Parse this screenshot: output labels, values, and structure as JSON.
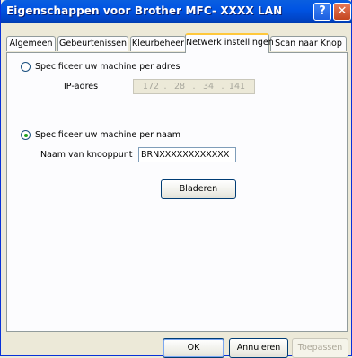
{
  "window": {
    "title": "Eigenschappen voor Brother MFC- XXXX   LAN",
    "help_glyph": "?",
    "close_glyph": "✕"
  },
  "tabs": [
    {
      "label": "Algemeen",
      "active": false
    },
    {
      "label": "Gebeurtenissen",
      "active": false
    },
    {
      "label": "Kleurbeheer",
      "active": false
    },
    {
      "label": "Netwerk instellingen",
      "active": true
    },
    {
      "label": "Scan naar Knop",
      "active": false
    }
  ],
  "address_mode": {
    "label": "Specificeer uw machine per adres",
    "checked": false,
    "ip_label": "IP-adres",
    "ip_octets": [
      "172",
      "28",
      "34",
      "141"
    ],
    "ip_enabled": false
  },
  "name_mode": {
    "label": "Specificeer uw machine per naam",
    "checked": true,
    "node_label": "Naam van knooppunt",
    "node_value": "BRNXXXXXXXXXXXX",
    "browse_label": "Bladeren"
  },
  "footer": {
    "ok_label": "OK",
    "cancel_label": "Annuleren",
    "apply_label": "Toepassen"
  },
  "colors": {
    "titlebar": "#0054e3",
    "active_tab_accent": "#ffc83c",
    "radio_dot": "#21a121"
  }
}
